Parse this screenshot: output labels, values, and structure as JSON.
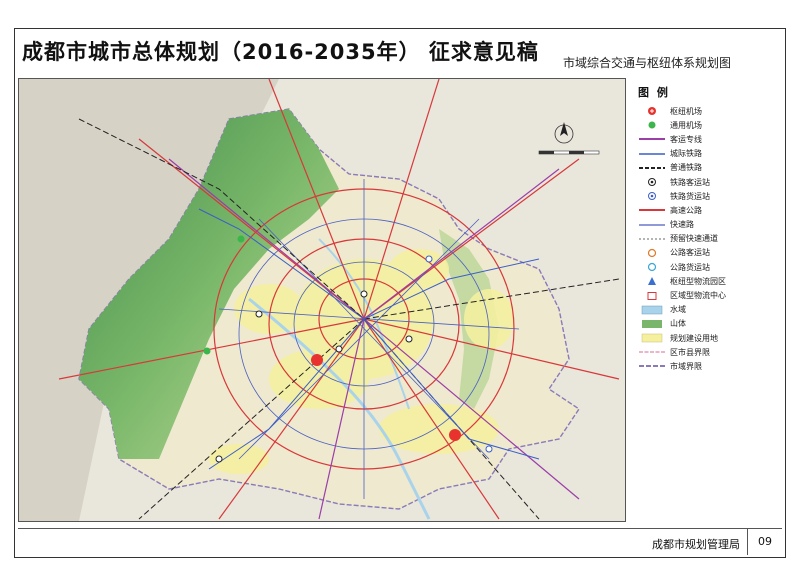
{
  "title": "成都市城市总体规划（2016-2035年） 征求意见稿",
  "subtitle": "市域综合交通与枢纽体系规划图",
  "legend": {
    "title": "图 例",
    "items": [
      {
        "label": "枢纽机场",
        "symbol": "hub-airport",
        "color": "#e8322d"
      },
      {
        "label": "通用机场",
        "symbol": "general-airport",
        "color": "#3cb54a"
      },
      {
        "label": "客运专线",
        "symbol": "passenger-line",
        "color": "#9b3ea8"
      },
      {
        "label": "城际铁路",
        "symbol": "intercity-rail",
        "color": "#3b5ec8"
      },
      {
        "label": "普通铁路",
        "symbol": "regular-rail",
        "color": "#222222"
      },
      {
        "label": "铁路客运站",
        "symbol": "rail-passenger-station",
        "color": "#222222"
      },
      {
        "label": "铁路货运站",
        "symbol": "rail-freight-station",
        "color": "#3b5ec8"
      },
      {
        "label": "高速公路",
        "symbol": "expressway",
        "color": "#d8383a"
      },
      {
        "label": "快速路",
        "symbol": "fast-road",
        "color": "#4a5fc1"
      },
      {
        "label": "预留快速通道",
        "symbol": "reserved-fast-corridor",
        "color": "#888888"
      },
      {
        "label": "公路客运站",
        "symbol": "road-passenger-station",
        "color": "#e07a2a"
      },
      {
        "label": "公路货运站",
        "symbol": "road-freight-station",
        "color": "#3aa6d8"
      },
      {
        "label": "枢纽型物流园区",
        "symbol": "logistics-park",
        "color": "#3b6fd0"
      },
      {
        "label": "区域型物流中心",
        "symbol": "logistics-center",
        "color": "#d8383a"
      },
      {
        "label": "水域",
        "symbol": "water",
        "color": "#a9d3ea"
      },
      {
        "label": "山体",
        "symbol": "mountain",
        "color": "#79b56a"
      },
      {
        "label": "规划建设用地",
        "symbol": "planned-land",
        "color": "#f4f0a0"
      },
      {
        "label": "区市县界限",
        "symbol": "county-boundary",
        "color": "#e08aa8"
      },
      {
        "label": "市域界限",
        "symbol": "city-boundary",
        "color": "#8a7ab8"
      }
    ]
  },
  "footer": {
    "bureau": "成都市规划管理局",
    "page": "09"
  }
}
